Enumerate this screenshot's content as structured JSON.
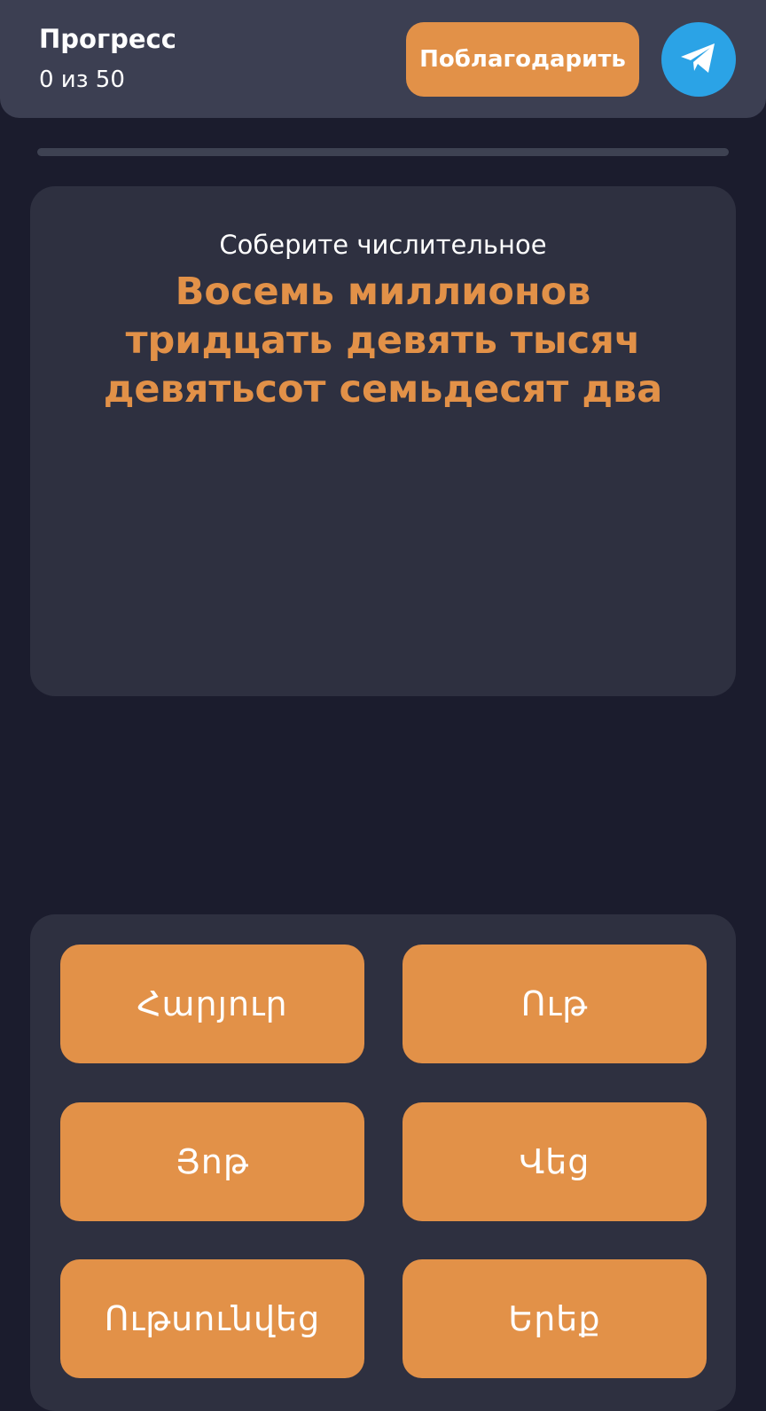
{
  "header": {
    "progress_title": "Прогресс",
    "progress_count": "0 из 50",
    "thank_button": "Поблагодарить",
    "share_icon": "telegram-icon"
  },
  "progress": {
    "completed": 0,
    "total": 50
  },
  "question": {
    "instruction": "Соберите числительное",
    "text": "Восемь миллионов тридцать девять тысяч девятьсот семьдесят два"
  },
  "answers": [
    "Հարյուր",
    "Ութ",
    "Յոթ",
    "Վեց",
    "Ութսունվեց",
    "Երեք"
  ],
  "colors": {
    "background": "#1b1c2d",
    "header": "#3c3f52",
    "card": "#2e3040",
    "accent": "#e29148",
    "telegram": "#2ba3e6"
  }
}
